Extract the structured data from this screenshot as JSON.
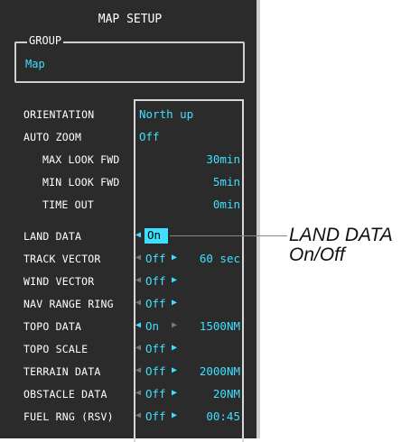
{
  "window": {
    "title": "MAP SETUP"
  },
  "group": {
    "label": "GROUP",
    "value": "Map"
  },
  "settings": [
    {
      "label": "ORIENTATION",
      "value": "North up"
    },
    {
      "label": "AUTO ZOOM",
      "value": "Off"
    },
    {
      "label": "MAX LOOK FWD",
      "value": "30min"
    },
    {
      "label": "MIN LOOK FWD",
      "value": "5min"
    },
    {
      "label": "TIME OUT",
      "value": "0min"
    },
    {
      "label": "LAND DATA",
      "value": "On"
    },
    {
      "label": "TRACK VECTOR",
      "value": "Off",
      "extra": "60 sec"
    },
    {
      "label": "WIND VECTOR",
      "value": "Off"
    },
    {
      "label": "NAV RANGE RING",
      "value": "Off"
    },
    {
      "label": "TOPO DATA",
      "value": "On",
      "extra": "1500NM"
    },
    {
      "label": "TOPO SCALE",
      "value": "Off"
    },
    {
      "label": "TERRAIN DATA",
      "value": "Off",
      "extra": "2000NM"
    },
    {
      "label": "OBSTACLE DATA",
      "value": "Off",
      "extra": "20NM"
    },
    {
      "label": "FUEL RNG (RSV)",
      "value": "Off",
      "extra": "00:45"
    }
  ],
  "callout": {
    "line1": "LAND DATA",
    "line2": "On/Off"
  },
  "colors": {
    "panel": "#2b2b2b",
    "value": "#3fe0ff",
    "label": "#ffffff",
    "selection": "#3fe0ff"
  }
}
